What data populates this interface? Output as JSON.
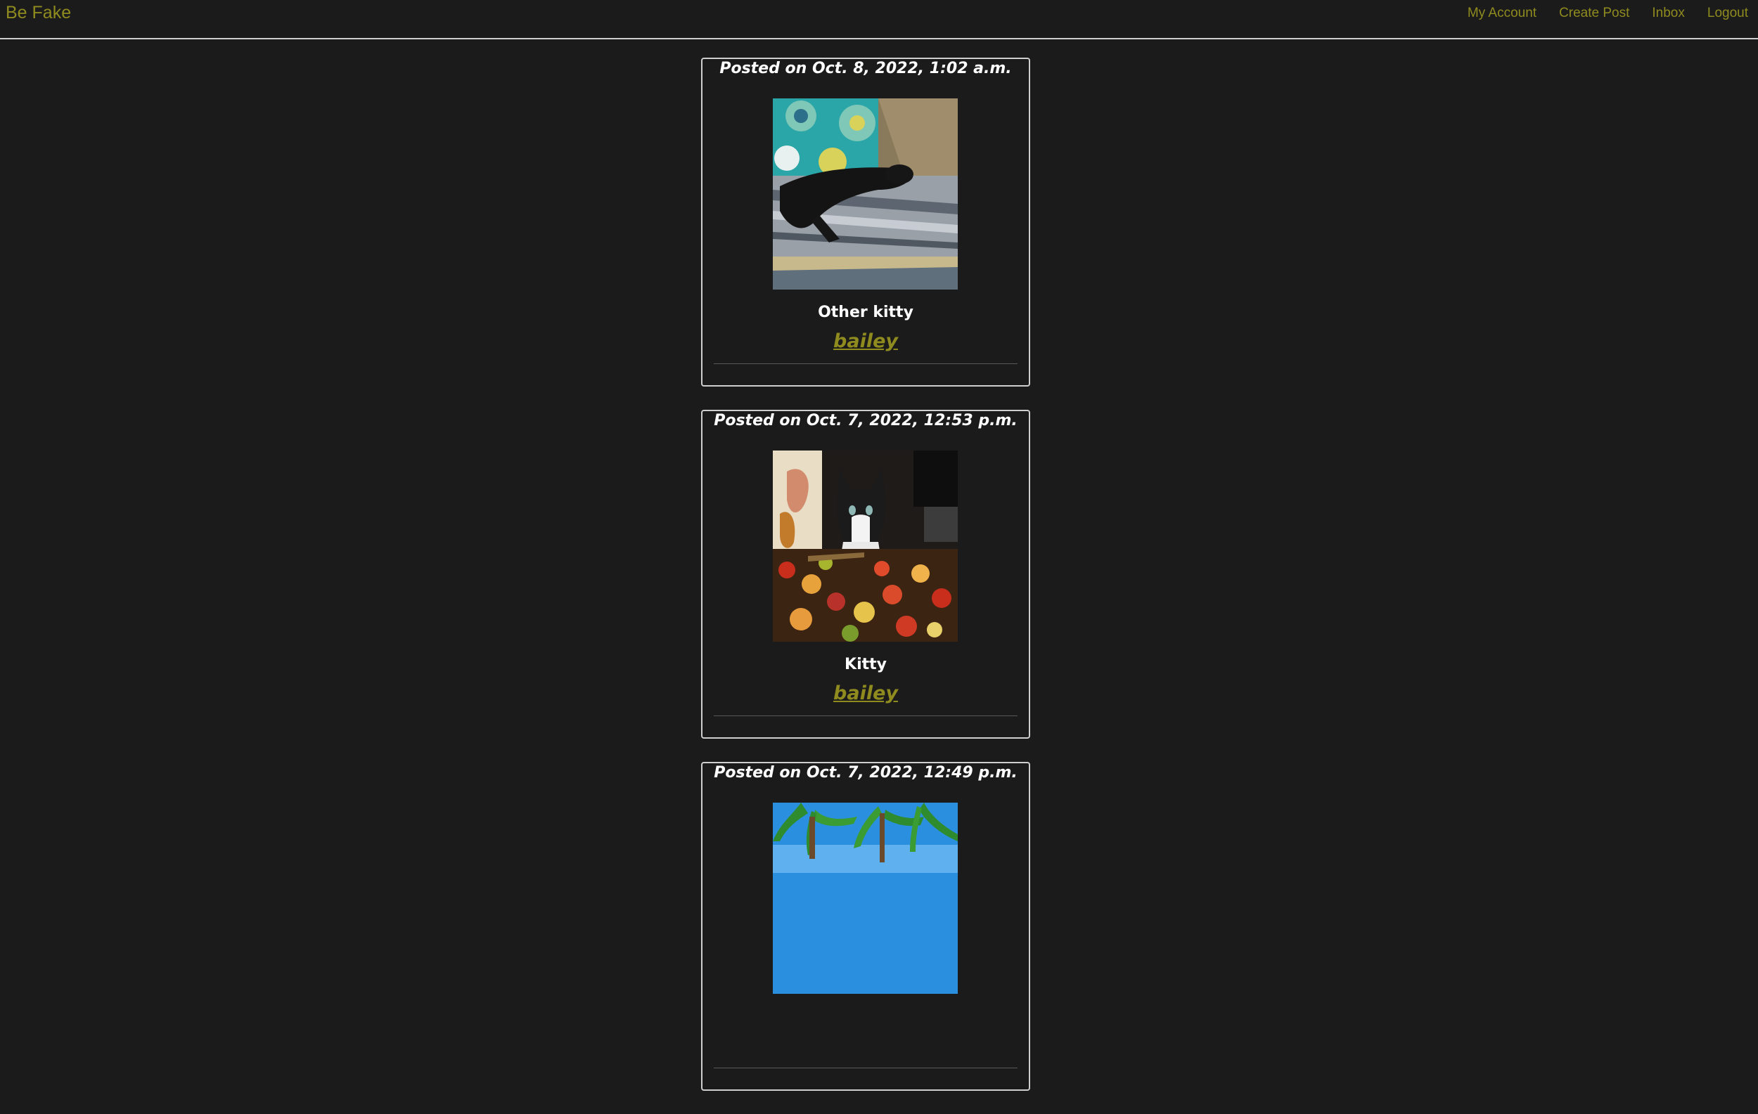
{
  "navbar": {
    "brand": "Be Fake",
    "links": [
      "My Account",
      "Create Post",
      "Inbox",
      "Logout"
    ]
  },
  "posts": [
    {
      "date": "Posted on Oct. 8, 2022, 1:02 a.m.",
      "caption": "Other kitty",
      "author": "bailey"
    },
    {
      "date": "Posted on Oct. 7, 2022, 12:53 p.m.",
      "caption": "Kitty",
      "author": "bailey"
    },
    {
      "date": "Posted on Oct. 7, 2022, 12:49 p.m.",
      "caption": "",
      "author": ""
    }
  ],
  "colors": {
    "background": "#1b1b1b",
    "accent": "#8f8b1f",
    "border": "#cfcfcf",
    "text": "#ffffff"
  }
}
